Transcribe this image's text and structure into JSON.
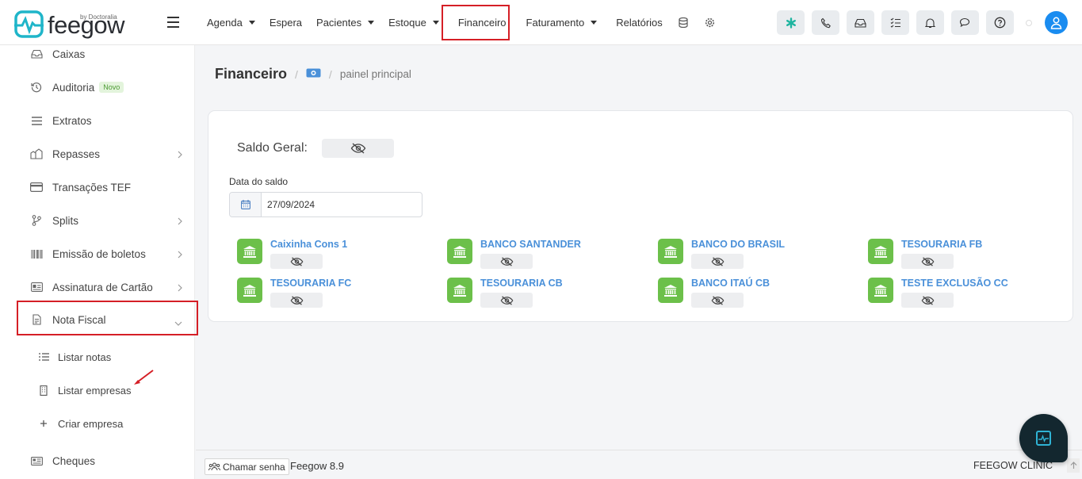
{
  "brand": {
    "name": "feegow",
    "by": "by Doctoralia",
    "color": "#1fb5c9"
  },
  "nav": {
    "items": [
      {
        "label": "Agenda",
        "dropdown": true
      },
      {
        "label": "Espera",
        "dropdown": false
      },
      {
        "label": "Pacientes",
        "dropdown": true
      },
      {
        "label": "Estoque",
        "dropdown": true
      },
      {
        "label": "Financeiro",
        "dropdown": false,
        "active": true
      },
      {
        "label": "Faturamento",
        "dropdown": true
      },
      {
        "label": "Relatórios",
        "dropdown": false
      }
    ],
    "icons": [
      "database-icon",
      "gear-icon"
    ]
  },
  "toolbar_icons": [
    "asterisk-icon",
    "phone-icon",
    "inbox-icon",
    "checklist-icon",
    "bell-icon",
    "chat-icon",
    "help-icon"
  ],
  "sidebar": {
    "items": [
      {
        "label": "Caixas",
        "icon": "inbox-icon"
      },
      {
        "label": "Auditoria",
        "icon": "history-icon",
        "badge": "Novo"
      },
      {
        "label": "Extratos",
        "icon": "list-icon"
      },
      {
        "label": "Repasses",
        "icon": "transfer-icon",
        "chevron": true
      },
      {
        "label": "Transações TEF",
        "icon": "card-icon"
      },
      {
        "label": "Splits",
        "icon": "split-icon",
        "chevron": true
      },
      {
        "label": "Emissão de boletos",
        "icon": "barcode-icon",
        "chevron": true
      },
      {
        "label": "Assinatura de Cartão",
        "icon": "id-card-icon",
        "chevron": true
      },
      {
        "label": "Nota Fiscal",
        "icon": "document-icon",
        "expanded": true
      }
    ],
    "subitems": [
      {
        "label": "Listar notas",
        "icon": "list-icon"
      },
      {
        "label": "Listar empresas",
        "icon": "building-icon"
      },
      {
        "label": "Criar empresa",
        "icon": "plus-icon"
      }
    ],
    "bottom_item": {
      "label": "Cheques",
      "icon": "cheque-icon"
    }
  },
  "breadcrumb": {
    "title": "Financeiro",
    "sub": "painel principal"
  },
  "panel": {
    "saldo_label": "Saldo Geral:",
    "date_label": "Data do saldo",
    "date_value": "27/09/2024",
    "accounts": [
      {
        "name": "Caixinha Cons 1"
      },
      {
        "name": "BANCO SANTANDER"
      },
      {
        "name": "BANCO DO BRASIL"
      },
      {
        "name": "TESOURARIA FB"
      },
      {
        "name": "TESOURARIA FC"
      },
      {
        "name": "TESOURARIA CB"
      },
      {
        "name": "BANCO ITAÚ CB"
      },
      {
        "name": "TESTE EXCLUSÃO CC"
      }
    ]
  },
  "footer": {
    "call_label": "Chamar senha",
    "version": "Feegow 8.9",
    "clinic": "FEEGOW CLINIC"
  }
}
